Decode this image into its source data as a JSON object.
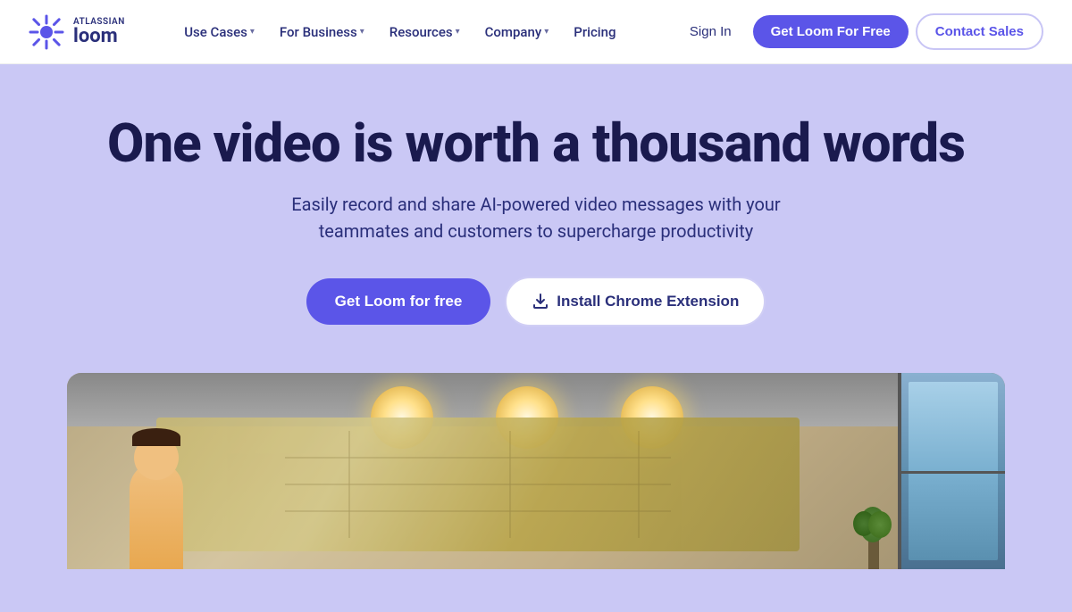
{
  "navbar": {
    "logo": {
      "atlassian_label": "ATLASSIAN",
      "loom_label": "loom"
    },
    "nav_links": [
      {
        "id": "use-cases",
        "label": "Use Cases",
        "has_dropdown": true
      },
      {
        "id": "for-business",
        "label": "For Business",
        "has_dropdown": true
      },
      {
        "id": "resources",
        "label": "Resources",
        "has_dropdown": true
      },
      {
        "id": "company",
        "label": "Company",
        "has_dropdown": true
      },
      {
        "id": "pricing",
        "label": "Pricing",
        "has_dropdown": false
      }
    ],
    "sign_in_label": "Sign In",
    "get_loom_label": "Get Loom For Free",
    "contact_sales_label": "Contact Sales"
  },
  "hero": {
    "title": "One video is worth a thousand words",
    "subtitle": "Easily record and share AI-powered video messages with your teammates and customers to supercharge productivity",
    "cta_primary_label": "Get Loom for free",
    "cta_secondary_label": "Install Chrome Extension",
    "colors": {
      "background": "#cac8f5",
      "title": "#1a1a4e",
      "subtitle": "#2a2f7a",
      "primary_btn": "#5b55e8",
      "secondary_btn_border": "#d0cef5"
    }
  },
  "icons": {
    "loom_sun": "☀",
    "download": "⬇"
  }
}
